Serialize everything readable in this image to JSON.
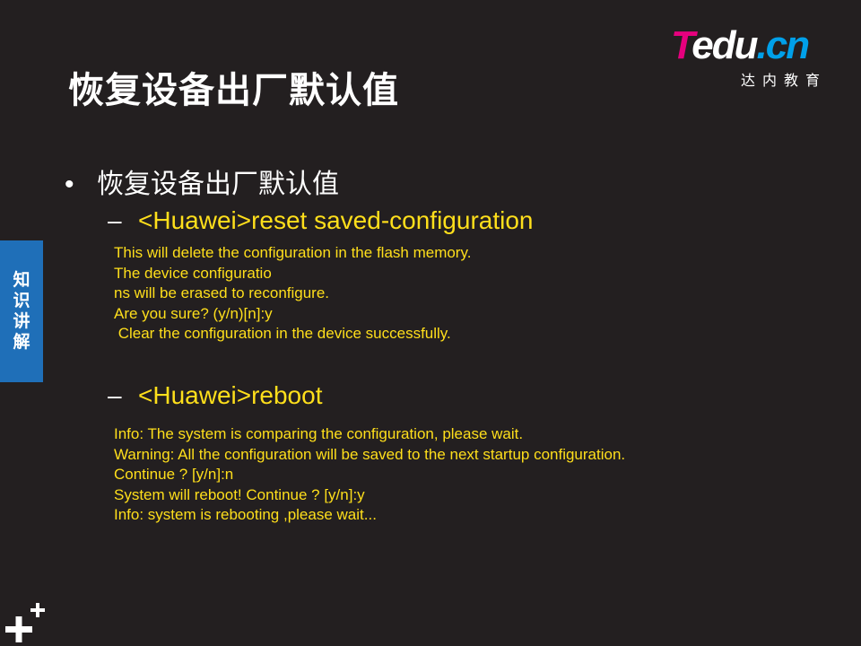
{
  "title": "恢复设备出厂默认值",
  "logo": {
    "word_t": "T",
    "word_rest": "edu",
    "word_dot": ".",
    "word_cn": "cn",
    "subtitle": "达内教育"
  },
  "side_tab": {
    "label": "知识讲解",
    "color": "#1f6fb8"
  },
  "bullet": {
    "text": "恢复设备出厂默认值"
  },
  "commands": [
    {
      "dash": "–",
      "text": "<Huawei>reset saved-configuration",
      "output": [
        "This will delete the configuration in the flash memory.",
        "The device configuratio",
        "ns will be erased to reconfigure.",
        "Are you sure? (y/n)[n]:y",
        " Clear the configuration in the device successfully."
      ]
    },
    {
      "dash": "–",
      "text": "<Huawei>reboot",
      "output": [
        "Info: The system is comparing the configuration, please wait.",
        "Warning: All the configuration will be saved to the next startup configuration.",
        "Continue ? [y/n]:n",
        "System will reboot! Continue ? [y/n]:y",
        "Info: system is rebooting ,please wait..."
      ]
    }
  ],
  "colors": {
    "background": "#231f20",
    "command_text": "#ffdf1b",
    "logo_pink": "#e6007e",
    "logo_blue": "#00a0e9"
  },
  "icons": {
    "corner": "plus-plus-icon"
  }
}
